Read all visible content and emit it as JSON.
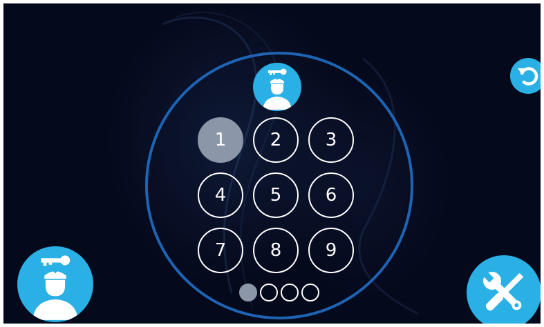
{
  "keypad": {
    "keys": [
      "1",
      "2",
      "3",
      "4",
      "5",
      "6",
      "7",
      "8",
      "9"
    ],
    "active_key": "1"
  },
  "pin_indicator": {
    "length": 4,
    "entered": 1
  },
  "icons": {
    "top": "nurse-key-icon",
    "undo": "undo-icon",
    "user": "nurse-key-icon",
    "settings": "wrench-screwdriver-icon"
  },
  "colors": {
    "background": "#05091c",
    "ring": "#1e64b4",
    "accent": "#2ab0e4",
    "active_key": "#8b97a8",
    "text": "#ffffff"
  }
}
